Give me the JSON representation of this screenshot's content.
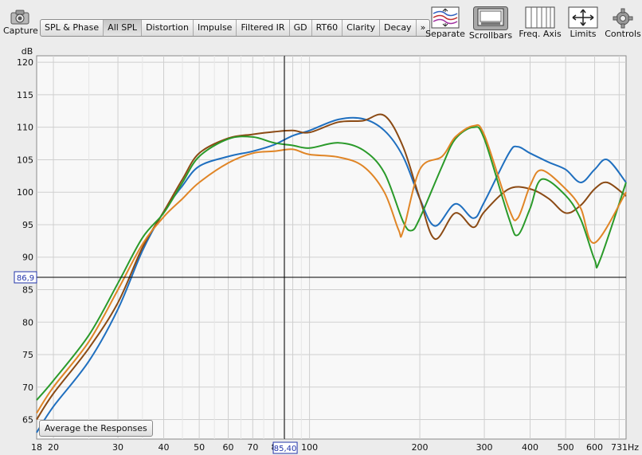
{
  "toolbar": {
    "capture": "Capture",
    "tabs": [
      "SPL & Phase",
      "All SPL",
      "Distortion",
      "Impulse",
      "Filtered IR",
      "GD",
      "RT60",
      "Clarity",
      "Decay",
      "»"
    ],
    "active_tab": 1,
    "right_tools": [
      "Separate",
      "Scrollbars",
      "Freq. Axis",
      "Limits",
      "Controls"
    ]
  },
  "average_button": "Average the Responses",
  "chart_data": {
    "type": "line",
    "xscale": "log",
    "ylabel": "dB",
    "xunit": "Hz",
    "xlim": [
      18,
      731
    ],
    "ylim": [
      62,
      121
    ],
    "yticks": [
      65,
      70,
      75,
      80,
      85,
      90,
      95,
      100,
      105,
      110,
      115,
      120
    ],
    "xticks": [
      20,
      30,
      40,
      50,
      60,
      70,
      80,
      100,
      200,
      300,
      400,
      500,
      600
    ],
    "xtick_labels": [
      "18",
      "20",
      "30",
      "40",
      "50",
      "60",
      "70",
      "8",
      "100",
      "200",
      "300",
      "400",
      "500",
      "600",
      "731Hz"
    ],
    "xtick_label_positions": [
      18,
      20,
      30,
      40,
      50,
      60,
      70,
      80,
      100,
      200,
      300,
      400,
      500,
      600,
      731
    ],
    "cursor": {
      "x": 85.4,
      "y": 86.9,
      "x_label": "85,40",
      "y_label": "86,9"
    },
    "grid": true,
    "series": [
      {
        "color": "#1f6fbf",
        "x": [
          18,
          20,
          25,
          30,
          35,
          40,
          45,
          50,
          60,
          70,
          80,
          90,
          100,
          120,
          140,
          160,
          180,
          200,
          220,
          250,
          280,
          300,
          350,
          370,
          400,
          450,
          500,
          550,
          600,
          650,
          731
        ],
        "y": [
          63,
          67,
          74,
          82,
          91,
          97,
          101,
          104,
          105.5,
          106.3,
          107.3,
          108.7,
          109.5,
          111.2,
          111.3,
          109.5,
          105.5,
          99,
          94.8,
          98.2,
          96,
          98.5,
          106,
          107,
          106,
          104.6,
          103.5,
          101.5,
          103.5,
          105,
          101.5
        ]
      },
      {
        "color": "#8b4a14",
        "x": [
          18,
          20,
          25,
          30,
          35,
          40,
          45,
          50,
          60,
          70,
          80,
          90,
          100,
          120,
          140,
          160,
          180,
          200,
          220,
          250,
          280,
          300,
          350,
          400,
          450,
          500,
          550,
          600,
          650,
          731
        ],
        "y": [
          65,
          69,
          76,
          83,
          91.5,
          97,
          102,
          106,
          108.3,
          108.9,
          109.3,
          109.5,
          109.2,
          110.8,
          111,
          111.8,
          107,
          99,
          92.8,
          96.8,
          94.6,
          97,
          100.5,
          100.5,
          99,
          96.8,
          98,
          100.5,
          101.5,
          99.4
        ]
      },
      {
        "color": "#2a9a2a",
        "x": [
          18,
          20,
          25,
          30,
          35,
          40,
          45,
          50,
          60,
          70,
          80,
          90,
          100,
          120,
          140,
          160,
          180,
          190,
          200,
          230,
          250,
          280,
          300,
          350,
          370,
          400,
          430,
          500,
          550,
          600,
          620,
          731
        ],
        "y": [
          68,
          71,
          78,
          86,
          93,
          96.8,
          101.5,
          105.5,
          108.2,
          108.5,
          107.6,
          107.2,
          106.8,
          107.6,
          106.5,
          103,
          95.5,
          94.1,
          96,
          104,
          108.2,
          110,
          108.2,
          96,
          93.4,
          97.5,
          102,
          99.5,
          95.8,
          89.6,
          89.5,
          101.5
        ]
      },
      {
        "color": "#e08526",
        "x": [
          18,
          20,
          25,
          30,
          35,
          40,
          45,
          50,
          60,
          70,
          80,
          90,
          100,
          120,
          140,
          160,
          175,
          180,
          200,
          230,
          250,
          280,
          300,
          350,
          370,
          400,
          430,
          500,
          550,
          600,
          731
        ],
        "y": [
          66,
          70,
          77,
          85,
          92,
          96.2,
          99,
          101.5,
          104.5,
          106,
          106.3,
          106.6,
          105.8,
          105.4,
          104,
          100,
          94.2,
          94,
          103.5,
          105.5,
          108.5,
          110.2,
          108.8,
          97.5,
          96,
          101,
          103.4,
          100.5,
          97.5,
          92.2,
          100
        ]
      }
    ]
  }
}
